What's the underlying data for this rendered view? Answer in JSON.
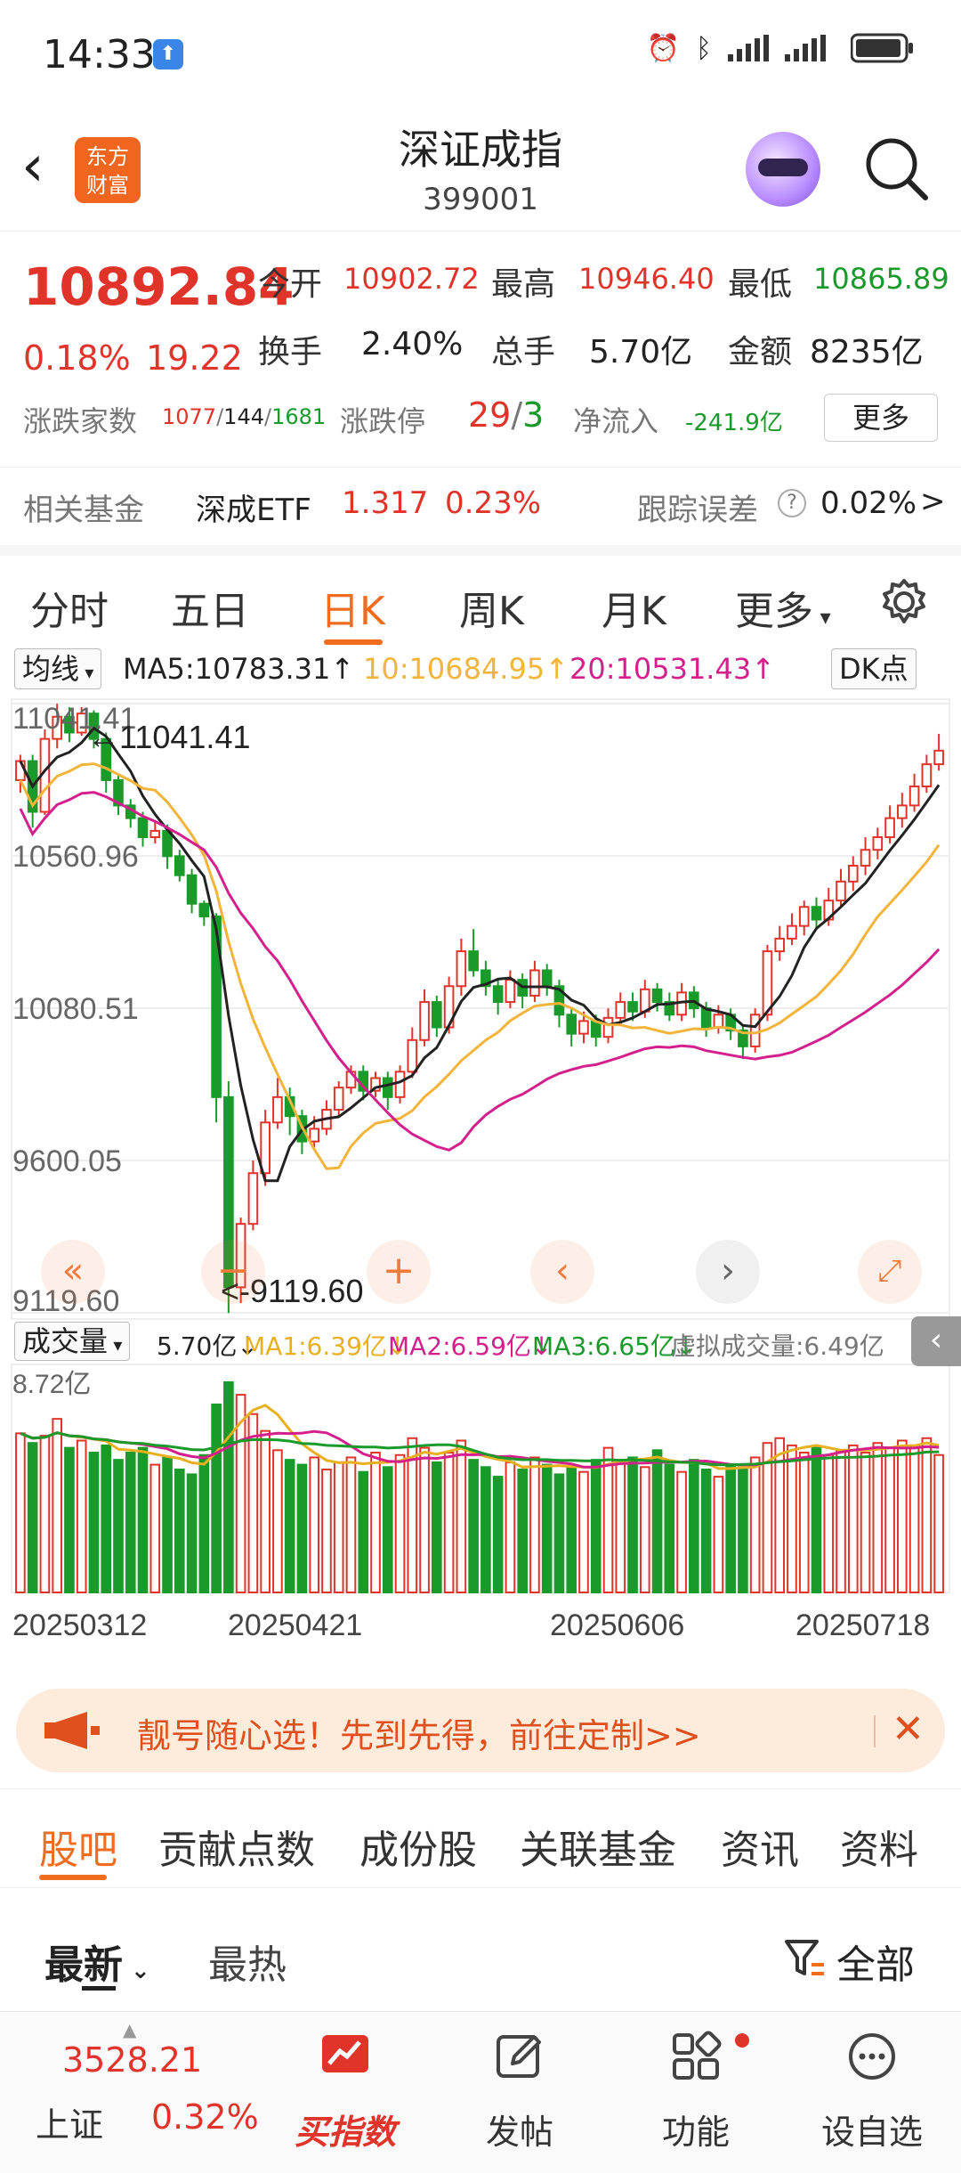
{
  "status_bar": {
    "time": "14:33"
  },
  "header": {
    "title": "深证成指",
    "code": "399001",
    "logo_line1": "东方",
    "logo_line2": "财富"
  },
  "quote": {
    "price": "10892.84",
    "change_pct": "0.18%",
    "change": "19.22",
    "open_label": "今开",
    "open": "10902.72",
    "high_label": "最高",
    "high": "10946.40",
    "low_label": "最低",
    "low": "10865.89",
    "turnover_label": "换手",
    "turnover": "2.40%",
    "volume_label": "总手",
    "volume": "5.70亿",
    "amount_label": "金额",
    "amount": "8235亿",
    "breadth_label": "涨跌家数",
    "breadth_up": "1077",
    "breadth_flat": "144",
    "breadth_down": "1681",
    "limit_label": "涨跌停",
    "limit_up": "29",
    "limit_down": "3",
    "netflow_label": "净流入",
    "netflow": "-241.9亿",
    "more": "更多"
  },
  "fund": {
    "label": "相关基金",
    "name": "深成ETF",
    "price": "1.317",
    "pct": "0.23%",
    "tracking_label": "跟踪误差",
    "tracking_value": "0.02%"
  },
  "period_tabs": [
    "分时",
    "五日",
    "日K",
    "周K",
    "月K",
    "更多"
  ],
  "ma_legend": {
    "selector": "均线",
    "ma5": "MA5:10783.31",
    "ma10": "10:10684.95",
    "ma20": "20:10531.43",
    "dk": "DK点"
  },
  "vol_legend": {
    "selector": "成交量",
    "vol": "5.70亿",
    "ma1": "MA1:6.39亿",
    "ma2": "MA2:6.59亿",
    "ma3": "MA3:6.65亿",
    "virtual": "虚拟成交量:6.49亿"
  },
  "chart_data": {
    "type": "candlestick",
    "y_ticks": [
      "11041.41",
      "10560.96",
      "10080.51",
      "9600.05",
      "9119.60"
    ],
    "ylim": [
      9119.6,
      11041.41
    ],
    "max_label": "11041.41",
    "min_label": "<-9119.60",
    "vol_max_label": "8.72亿",
    "x_labels": [
      "20250312",
      "20250421",
      "20250606",
      "20250718"
    ],
    "colors": {
      "up": "#e0342b",
      "down": "#1a9a2a",
      "ma5": "#222222",
      "ma10": "#f2b43a",
      "ma20": "#d4208c"
    },
    "candles": [
      [
        10800,
        10860,
        10760,
        10880
      ],
      [
        10860,
        10700,
        10650,
        10880
      ],
      [
        10700,
        10930,
        10690,
        10960
      ],
      [
        10930,
        11000,
        10900,
        11041
      ],
      [
        11000,
        10950,
        10920,
        11030
      ],
      [
        10950,
        11010,
        10940,
        11030
      ],
      [
        11010,
        10930,
        10900,
        11020
      ],
      [
        10930,
        10800,
        10760,
        10950
      ],
      [
        10800,
        10720,
        10690,
        10820
      ],
      [
        10720,
        10680,
        10650,
        10740
      ],
      [
        10680,
        10620,
        10590,
        10700
      ],
      [
        10620,
        10640,
        10600,
        10670
      ],
      [
        10640,
        10560,
        10520,
        10660
      ],
      [
        10560,
        10500,
        10480,
        10580
      ],
      [
        10500,
        10410,
        10380,
        10520
      ],
      [
        10410,
        10370,
        10340,
        10420
      ],
      [
        10370,
        9800,
        9720,
        10380
      ],
      [
        9800,
        9200,
        9119,
        9850
      ],
      [
        9200,
        9400,
        9150,
        9420
      ],
      [
        9400,
        9560,
        9380,
        9600
      ],
      [
        9560,
        9720,
        9520,
        9760
      ],
      [
        9720,
        9800,
        9700,
        9860
      ],
      [
        9800,
        9740,
        9680,
        9830
      ],
      [
        9740,
        9660,
        9620,
        9760
      ],
      [
        9660,
        9700,
        9640,
        9740
      ],
      [
        9700,
        9760,
        9680,
        9790
      ],
      [
        9760,
        9830,
        9740,
        9850
      ],
      [
        9830,
        9880,
        9810,
        9900
      ],
      [
        9880,
        9820,
        9790,
        9900
      ],
      [
        9820,
        9860,
        9800,
        9880
      ],
      [
        9860,
        9800,
        9760,
        9880
      ],
      [
        9800,
        9880,
        9780,
        9900
      ],
      [
        9880,
        9980,
        9860,
        10020
      ],
      [
        9980,
        10100,
        9960,
        10140
      ],
      [
        10100,
        10020,
        9990,
        10120
      ],
      [
        10020,
        10150,
        10000,
        10180
      ],
      [
        10150,
        10260,
        10120,
        10300
      ],
      [
        10260,
        10200,
        10180,
        10330
      ],
      [
        10200,
        10150,
        10120,
        10230
      ],
      [
        10150,
        10100,
        10060,
        10170
      ],
      [
        10100,
        10170,
        10080,
        10200
      ],
      [
        10170,
        10120,
        10080,
        10190
      ],
      [
        10120,
        10200,
        10100,
        10230
      ],
      [
        10200,
        10150,
        10120,
        10220
      ],
      [
        10150,
        10060,
        10020,
        10170
      ],
      [
        10060,
        10000,
        9960,
        10080
      ],
      [
        10000,
        10040,
        9970,
        10070
      ],
      [
        10040,
        9990,
        9960,
        10060
      ],
      [
        9990,
        10050,
        9970,
        10080
      ],
      [
        10050,
        10100,
        10030,
        10130
      ],
      [
        10100,
        10070,
        10040,
        10130
      ],
      [
        10070,
        10140,
        10050,
        10170
      ],
      [
        10140,
        10100,
        10070,
        10160
      ],
      [
        10100,
        10060,
        10040,
        10130
      ],
      [
        10060,
        10130,
        10040,
        10160
      ],
      [
        10130,
        10080,
        10050,
        10150
      ],
      [
        10080,
        10020,
        9990,
        10100
      ],
      [
        10020,
        10060,
        10000,
        10090
      ],
      [
        10060,
        10010,
        9980,
        10080
      ],
      [
        10010,
        9960,
        9920,
        10030
      ],
      [
        9960,
        10060,
        9940,
        10080
      ],
      [
        10060,
        10260,
        10040,
        10280
      ],
      [
        10260,
        10300,
        10230,
        10340
      ],
      [
        10300,
        10340,
        10280,
        10380
      ],
      [
        10340,
        10400,
        10310,
        10420
      ],
      [
        10400,
        10360,
        10330,
        10430
      ],
      [
        10360,
        10420,
        10340,
        10460
      ],
      [
        10420,
        10480,
        10400,
        10520
      ],
      [
        10480,
        10530,
        10450,
        10560
      ],
      [
        10530,
        10580,
        10500,
        10620
      ],
      [
        10580,
        10620,
        10550,
        10650
      ],
      [
        10620,
        10680,
        10600,
        10720
      ],
      [
        10680,
        10720,
        10650,
        10760
      ],
      [
        10720,
        10780,
        10700,
        10820
      ],
      [
        10780,
        10850,
        10760,
        10880
      ],
      [
        10850,
        10893,
        10830,
        10946
      ]
    ],
    "volume": [
      6.6,
      6.2,
      6.5,
      7.2,
      6.0,
      6.3,
      5.8,
      6.1,
      5.5,
      5.8,
      6.0,
      5.3,
      5.6,
      5.1,
      4.9,
      5.7,
      7.8,
      8.72,
      8.2,
      7.4,
      6.7,
      5.9,
      5.5,
      5.3,
      5.6,
      5.1,
      5.4,
      5.6,
      5.0,
      5.8,
      5.2,
      5.7,
      6.4,
      6.0,
      5.4,
      5.8,
      6.3,
      5.5,
      5.2,
      4.8,
      5.4,
      5.1,
      5.6,
      5.3,
      4.9,
      5.2,
      5.0,
      5.5,
      6.0,
      5.4,
      5.6,
      5.2,
      5.9,
      5.3,
      5.0,
      5.5,
      5.1,
      4.8,
      5.3,
      5.2,
      5.6,
      6.2,
      6.4,
      6.1,
      5.8,
      6.0,
      5.7,
      5.9,
      6.1,
      5.8,
      6.2,
      6.0,
      6.3,
      6.1,
      6.4,
      5.7
    ]
  },
  "banner": {
    "text": "靓号随心选！先到先得，前往定制>>"
  },
  "content_tabs": [
    "股吧",
    "贡献点数",
    "成份股",
    "关联基金",
    "资讯",
    "资料"
  ],
  "sort": {
    "latest": "最新",
    "hot": "最热",
    "filter": "全部"
  },
  "bottom_nav": {
    "index_price": "3528.21",
    "index_name": "上证",
    "index_pct": "0.32%",
    "items": [
      "买指数",
      "发帖",
      "功能",
      "设自选"
    ]
  }
}
